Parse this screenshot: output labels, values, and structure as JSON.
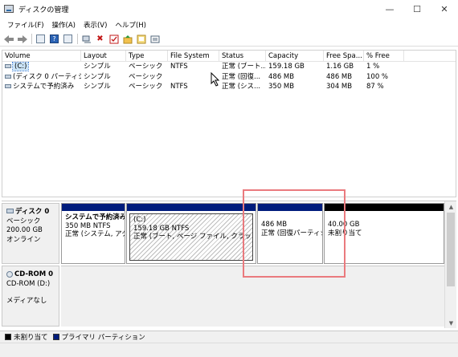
{
  "window": {
    "title": "ディスクの管理",
    "minimize": "—",
    "maximize": "☐",
    "close": "✕"
  },
  "menu": [
    "ファイル(F)",
    "操作(A)",
    "表示(V)",
    "ヘルプ(H)"
  ],
  "toolbar": {
    "icons": [
      "back-arrow-icon",
      "forward-arrow-icon",
      "properties-icon",
      "help-icon",
      "console-icon",
      "connect-icon",
      "delete-icon",
      "check-icon",
      "folder-up-icon",
      "image-icon",
      "list-icon"
    ],
    "delete_glyph": "✖",
    "check_glyph": "✔",
    "help_glyph": "?"
  },
  "volume_list": {
    "columns": [
      "Volume",
      "Layout",
      "Type",
      "File System",
      "Status",
      "Capacity",
      "Free Spa...",
      "% Free"
    ],
    "rows": [
      {
        "volume": "(C:)",
        "layout": "シンプル",
        "type": "ベーシック",
        "fs": "NTFS",
        "status": "正常 (ブート...",
        "capacity": "159.18 GB",
        "free": "1.16 GB",
        "pct": "1 %"
      },
      {
        "volume": "(ディスク 0 パーティシ...",
        "layout": "シンプル",
        "type": "ベーシック",
        "fs": "",
        "status": "正常 (回復...",
        "capacity": "486 MB",
        "free": "486 MB",
        "pct": "100 %"
      },
      {
        "volume": "システムで予約済み",
        "layout": "シンプル",
        "type": "ベーシック",
        "fs": "NTFS",
        "status": "正常 (シス...",
        "capacity": "350 MB",
        "free": "304 MB",
        "pct": "87 %"
      }
    ]
  },
  "disks": [
    {
      "name": "ディスク 0",
      "type": "ベーシック",
      "size": "200.00 GB",
      "state": "オンライン",
      "partitions": [
        {
          "name": "システムで予約済み",
          "size_fs": "350 MB NTFS",
          "status": "正常 (システム, アク"
        },
        {
          "name": "(C:)",
          "size_fs": "159.18 GB NTFS",
          "status": "正常 (ブート, ページ ファイル, クラッシュ ダン"
        },
        {
          "name": "",
          "size_fs": "486 MB",
          "status": "正常 (回復パーティシ"
        },
        {
          "name": "",
          "size_fs": "40.00 GB",
          "status": "未割り当て"
        }
      ]
    },
    {
      "name": "CD-ROM 0",
      "type": "CD-ROM (D:)",
      "state": "メディアなし"
    }
  ],
  "legend": {
    "unallocated": "未割り当て",
    "primary": "プライマリ パーティション",
    "unallocated_color": "#000000",
    "primary_color": "#001c7c"
  },
  "colors": {
    "primary_partition": "#001c7c",
    "unallocated": "#000000",
    "highlight_box": "#ea7a7e"
  }
}
